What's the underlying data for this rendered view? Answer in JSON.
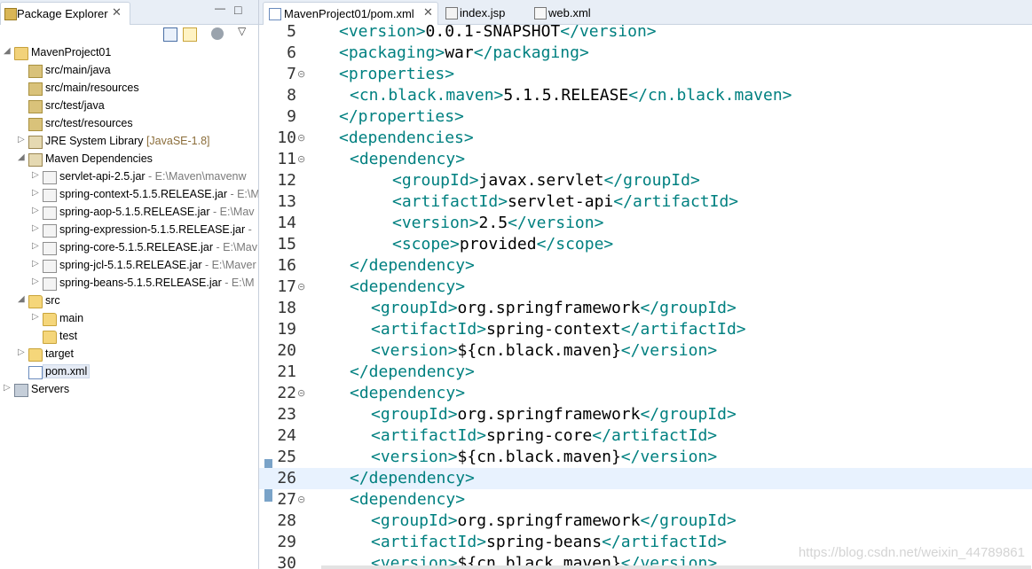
{
  "explorer": {
    "tab_title": "Package Explorer",
    "close_glyph": "✕",
    "minimize_glyph": "—",
    "maximize_glyph": "□",
    "menu_glyph": "▽",
    "tree": [
      {
        "label": "MavenProject01",
        "icon": "maven-project-icon",
        "arrow": "◢",
        "indent": 0
      },
      {
        "label": "src/main/java",
        "icon": "source-folder-icon",
        "arrow": "",
        "indent": 1
      },
      {
        "label": "src/main/resources",
        "icon": "source-folder-icon",
        "arrow": "",
        "indent": 1
      },
      {
        "label": "src/test/java",
        "icon": "source-folder-icon",
        "arrow": "",
        "indent": 1
      },
      {
        "label": "src/test/resources",
        "icon": "source-folder-icon",
        "arrow": "",
        "indent": 1
      },
      {
        "label": "JRE System Library",
        "deco": "[JavaSE-1.8]",
        "icon": "library-icon",
        "arrow": "▷",
        "indent": 1
      },
      {
        "label": "Maven Dependencies",
        "icon": "library-icon",
        "arrow": "◢",
        "indent": 1
      },
      {
        "label": "servlet-api-2.5.jar",
        "path": " - E:\\Maven\\mavenw",
        "icon": "jar-icon",
        "arrow": "▷",
        "indent": 2
      },
      {
        "label": "spring-context-5.1.5.RELEASE.jar",
        "path": " - E:\\M",
        "icon": "jar-icon",
        "arrow": "▷",
        "indent": 2
      },
      {
        "label": "spring-aop-5.1.5.RELEASE.jar",
        "path": " - E:\\Mav",
        "icon": "jar-icon",
        "arrow": "▷",
        "indent": 2
      },
      {
        "label": "spring-expression-5.1.5.RELEASE.jar",
        "path": " -",
        "icon": "jar-icon",
        "arrow": "▷",
        "indent": 2
      },
      {
        "label": "spring-core-5.1.5.RELEASE.jar",
        "path": " - E:\\Mav",
        "icon": "jar-icon",
        "arrow": "▷",
        "indent": 2
      },
      {
        "label": "spring-jcl-5.1.5.RELEASE.jar",
        "path": " - E:\\Maver",
        "icon": "jar-icon",
        "arrow": "▷",
        "indent": 2
      },
      {
        "label": "spring-beans-5.1.5.RELEASE.jar",
        "path": " - E:\\M",
        "icon": "jar-icon",
        "arrow": "▷",
        "indent": 2
      },
      {
        "label": "src",
        "icon": "folder-icon",
        "arrow": "◢",
        "indent": 1
      },
      {
        "label": "main",
        "icon": "folder-icon",
        "arrow": "▷",
        "indent": 2
      },
      {
        "label": "test",
        "icon": "folder-icon",
        "arrow": "",
        "indent": 2
      },
      {
        "label": "target",
        "icon": "folder-icon",
        "arrow": "▷",
        "indent": 1
      },
      {
        "label": "pom.xml",
        "icon": "xml-file-icon",
        "arrow": "",
        "indent": 1,
        "selected": true
      },
      {
        "label": "Servers",
        "icon": "server-folder-icon",
        "arrow": "▷",
        "indent": 0
      }
    ]
  },
  "editor": {
    "tabs": [
      {
        "label": "MavenProject01/pom.xml",
        "active": true,
        "close": "✕"
      },
      {
        "label": "index.jsp",
        "active": false
      },
      {
        "label": "web.xml",
        "active": false
      }
    ],
    "current_line": "26",
    "lines": [
      {
        "n": "5",
        "fold": "",
        "indent": 1,
        "parts": [
          [
            "tg",
            "<version>"
          ],
          [
            "tx",
            "0.0.1-SNAPSHOT"
          ],
          [
            "tg",
            "</version>"
          ]
        ]
      },
      {
        "n": "6",
        "fold": "",
        "indent": 1,
        "parts": [
          [
            "tg",
            "<packaging>"
          ],
          [
            "tx",
            "war"
          ],
          [
            "tg",
            "</packaging>"
          ]
        ]
      },
      {
        "n": "7",
        "fold": "⊝",
        "indent": 1,
        "parts": [
          [
            "tg",
            "<properties>"
          ]
        ]
      },
      {
        "n": "8",
        "fold": "",
        "indent": 2,
        "parts": [
          [
            "tg",
            "<cn.black.maven>"
          ],
          [
            "tx",
            "5.1.5.RELEASE"
          ],
          [
            "tg",
            "</cn.black.maven>"
          ]
        ]
      },
      {
        "n": "9",
        "fold": "",
        "indent": 1,
        "parts": [
          [
            "tg",
            "</properties>"
          ]
        ]
      },
      {
        "n": "10",
        "fold": "⊝",
        "indent": 1,
        "parts": [
          [
            "tg",
            "<dependencies>"
          ]
        ]
      },
      {
        "n": "11",
        "fold": "⊝",
        "indent": 2,
        "parts": [
          [
            "tg",
            "<dependency>"
          ]
        ]
      },
      {
        "n": "12",
        "fold": "",
        "indent": 6,
        "parts": [
          [
            "tg",
            "<groupId>"
          ],
          [
            "tx",
            "javax.servlet"
          ],
          [
            "tg",
            "</groupId>"
          ]
        ]
      },
      {
        "n": "13",
        "fold": "",
        "indent": 6,
        "parts": [
          [
            "tg",
            "<artifactId>"
          ],
          [
            "tx",
            "servlet-api"
          ],
          [
            "tg",
            "</artifactId>"
          ]
        ]
      },
      {
        "n": "14",
        "fold": "",
        "indent": 6,
        "parts": [
          [
            "tg",
            "<version>"
          ],
          [
            "tx",
            "2.5"
          ],
          [
            "tg",
            "</version>"
          ]
        ]
      },
      {
        "n": "15",
        "fold": "",
        "indent": 6,
        "parts": [
          [
            "tg",
            "<scope>"
          ],
          [
            "tx",
            "provided"
          ],
          [
            "tg",
            "</scope>"
          ]
        ]
      },
      {
        "n": "16",
        "fold": "",
        "indent": 2,
        "parts": [
          [
            "tg",
            "</dependency>"
          ]
        ]
      },
      {
        "n": "17",
        "fold": "⊝",
        "indent": 2,
        "parts": [
          [
            "tg",
            "<dependency>"
          ]
        ]
      },
      {
        "n": "18",
        "fold": "",
        "indent": 4,
        "parts": [
          [
            "tg",
            "<groupId>"
          ],
          [
            "tx",
            "org.springframework"
          ],
          [
            "tg",
            "</groupId>"
          ]
        ]
      },
      {
        "n": "19",
        "fold": "",
        "indent": 4,
        "parts": [
          [
            "tg",
            "<artifactId>"
          ],
          [
            "tx",
            "spring-context"
          ],
          [
            "tg",
            "</artifactId>"
          ]
        ]
      },
      {
        "n": "20",
        "fold": "",
        "indent": 4,
        "parts": [
          [
            "tg",
            "<version>"
          ],
          [
            "tx",
            "${cn.black.maven}"
          ],
          [
            "tg",
            "</version>"
          ]
        ]
      },
      {
        "n": "21",
        "fold": "",
        "indent": 2,
        "parts": [
          [
            "tg",
            "</dependency>"
          ]
        ]
      },
      {
        "n": "22",
        "fold": "⊝",
        "indent": 2,
        "parts": [
          [
            "tg",
            "<dependency>"
          ]
        ]
      },
      {
        "n": "23",
        "fold": "",
        "indent": 4,
        "parts": [
          [
            "tg",
            "<groupId>"
          ],
          [
            "tx",
            "org.springframework"
          ],
          [
            "tg",
            "</groupId>"
          ]
        ]
      },
      {
        "n": "24",
        "fold": "",
        "indent": 4,
        "parts": [
          [
            "tg",
            "<artifactId>"
          ],
          [
            "tx",
            "spring-core"
          ],
          [
            "tg",
            "</artifactId>"
          ]
        ]
      },
      {
        "n": "25",
        "fold": "",
        "indent": 4,
        "parts": [
          [
            "tg",
            "<version>"
          ],
          [
            "tx",
            "${cn.black.maven}"
          ],
          [
            "tg",
            "</version>"
          ]
        ]
      },
      {
        "n": "26",
        "fold": "",
        "indent": 2,
        "parts": [
          [
            "tg",
            "</dependency>"
          ]
        ]
      },
      {
        "n": "27",
        "fold": "⊝",
        "indent": 2,
        "parts": [
          [
            "tg",
            "<dependency>"
          ]
        ]
      },
      {
        "n": "28",
        "fold": "",
        "indent": 4,
        "parts": [
          [
            "tg",
            "<groupId>"
          ],
          [
            "tx",
            "org.springframework"
          ],
          [
            "tg",
            "</groupId>"
          ]
        ]
      },
      {
        "n": "29",
        "fold": "",
        "indent": 4,
        "parts": [
          [
            "tg",
            "<artifactId>"
          ],
          [
            "tx",
            "spring-beans"
          ],
          [
            "tg",
            "</artifactId>"
          ]
        ]
      },
      {
        "n": "30",
        "fold": "",
        "indent": 4,
        "parts": [
          [
            "tg",
            "<version>"
          ],
          [
            "tx",
            "${cn.black.maven}"
          ],
          [
            "tg",
            "</version>"
          ]
        ]
      }
    ]
  },
  "watermark": "https://blog.csdn.net/weixin_44789861"
}
